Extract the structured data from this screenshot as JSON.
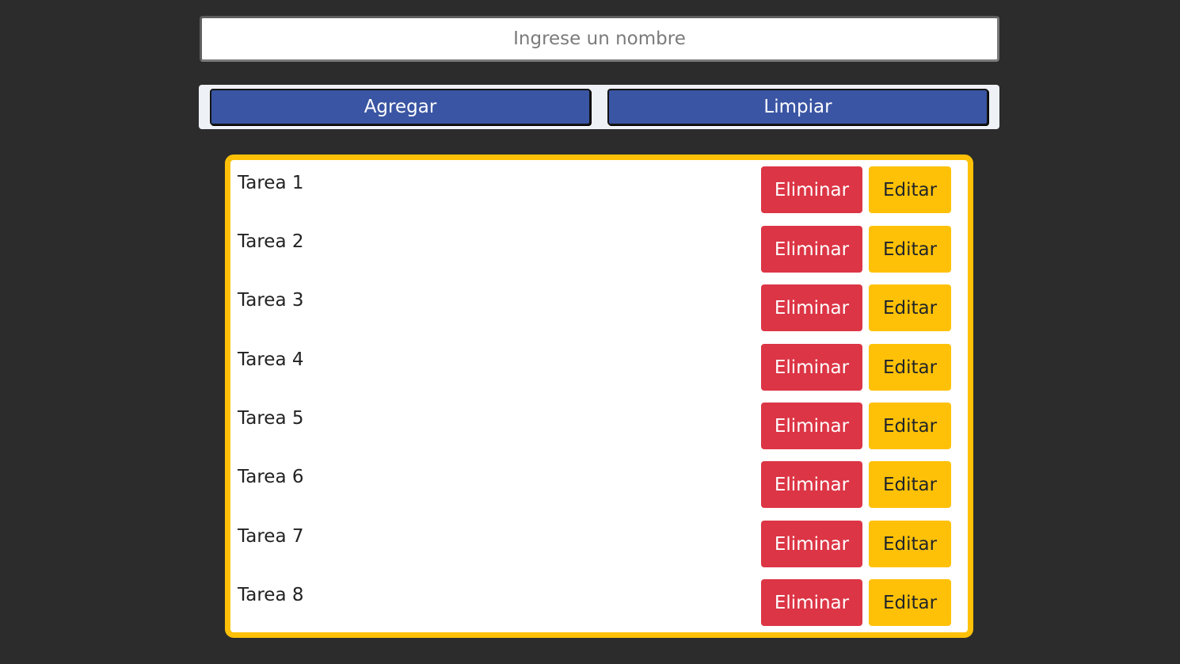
{
  "form": {
    "placeholder": "Ingrese un nombre",
    "value": "",
    "add_label": "Agregar",
    "clear_label": "Limpiar"
  },
  "tasks": [
    {
      "name": "Tarea 1",
      "delete_label": "Eliminar",
      "edit_label": "Editar"
    },
    {
      "name": "Tarea 2",
      "delete_label": "Eliminar",
      "edit_label": "Editar"
    },
    {
      "name": "Tarea 3",
      "delete_label": "Eliminar",
      "edit_label": "Editar"
    },
    {
      "name": "Tarea 4",
      "delete_label": "Eliminar",
      "edit_label": "Editar"
    },
    {
      "name": "Tarea 5",
      "delete_label": "Eliminar",
      "edit_label": "Editar"
    },
    {
      "name": "Tarea 6",
      "delete_label": "Eliminar",
      "edit_label": "Editar"
    },
    {
      "name": "Tarea 7",
      "delete_label": "Eliminar",
      "edit_label": "Editar"
    },
    {
      "name": "Tarea 8",
      "delete_label": "Eliminar",
      "edit_label": "Editar"
    }
  ],
  "colors": {
    "background": "#2c2c2c",
    "primary": "#3a55a3",
    "danger": "#dc3545",
    "warning": "#ffc107"
  }
}
